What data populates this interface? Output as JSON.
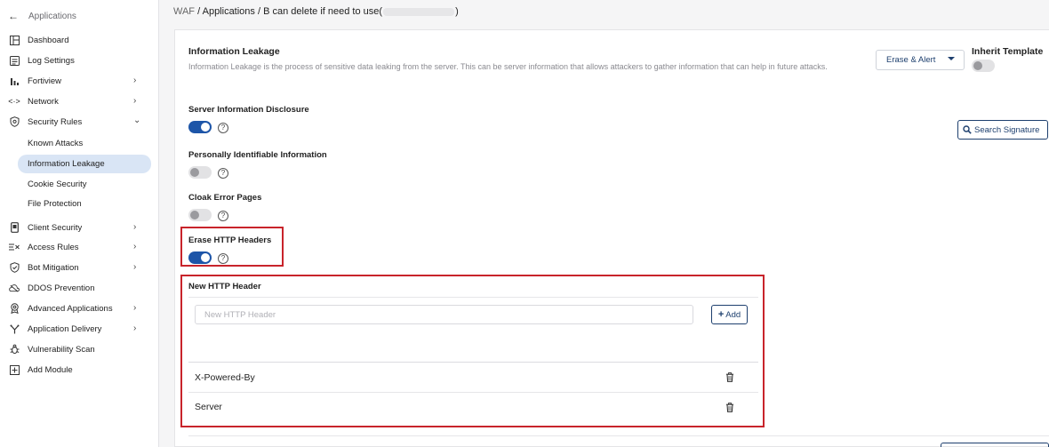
{
  "breadcrumb": {
    "root": "WAF",
    "sep": "/",
    "section": "Applications",
    "page_prefix": "B can delete if need to use(",
    "page_suffix": ")"
  },
  "sidebar": {
    "back_label": "Applications",
    "items": [
      {
        "label": "Dashboard",
        "icon": "dashboard-icon"
      },
      {
        "label": "Log Settings",
        "icon": "log-icon"
      },
      {
        "label": "Fortiview",
        "icon": "chart-icon",
        "chevron": "right"
      },
      {
        "label": "Network",
        "icon": "network-icon",
        "chevron": "right"
      },
      {
        "label": "Security Rules",
        "icon": "shield-icon",
        "chevron": "down"
      },
      {
        "label": "Client Security",
        "icon": "phone-icon",
        "chevron": "right"
      },
      {
        "label": "Access Rules",
        "icon": "access-icon",
        "chevron": "right"
      },
      {
        "label": "Bot Mitigation",
        "icon": "bot-shield-icon",
        "chevron": "right"
      },
      {
        "label": "DDOS Prevention",
        "icon": "cloud-icon"
      },
      {
        "label": "Advanced Applications",
        "icon": "badge-icon",
        "chevron": "right"
      },
      {
        "label": "Application Delivery",
        "icon": "fork-icon",
        "chevron": "right"
      },
      {
        "label": "Vulnerability Scan",
        "icon": "bug-icon"
      },
      {
        "label": "Add Module",
        "icon": "plus-square-icon"
      }
    ],
    "sub_items": [
      {
        "label": "Known Attacks"
      },
      {
        "label": "Information Leakage",
        "active": true
      },
      {
        "label": "Cookie Security"
      },
      {
        "label": "File Protection"
      }
    ]
  },
  "main": {
    "title": "Information Leakage",
    "description": "Information Leakage is the process of sensitive data leaking from the server. This can be server information that allows attackers to gather information that can help in future attacks.",
    "action_dropdown": "Erase & Alert",
    "inherit_template_label": "Inherit Template",
    "inherit_template_on": false,
    "search_signature_label": "Search Signature",
    "help_glyph": "?",
    "settings": [
      {
        "label": "Server Information Disclosure",
        "on": true
      },
      {
        "label": "Personally Identifiable Information",
        "on": false
      },
      {
        "label": "Cloak Error Pages",
        "on": false
      },
      {
        "label": "Erase HTTP Headers",
        "on": true
      }
    ],
    "new_header": {
      "title": "New HTTP Header",
      "placeholder": "New HTTP Header",
      "value": "",
      "add_label": "Add",
      "add_glyph": "+"
    },
    "headers": [
      {
        "name": "X-Powered-By"
      },
      {
        "name": "Server"
      }
    ],
    "highlight_color": "#c8242b",
    "accent_color": "#1d55a8"
  }
}
